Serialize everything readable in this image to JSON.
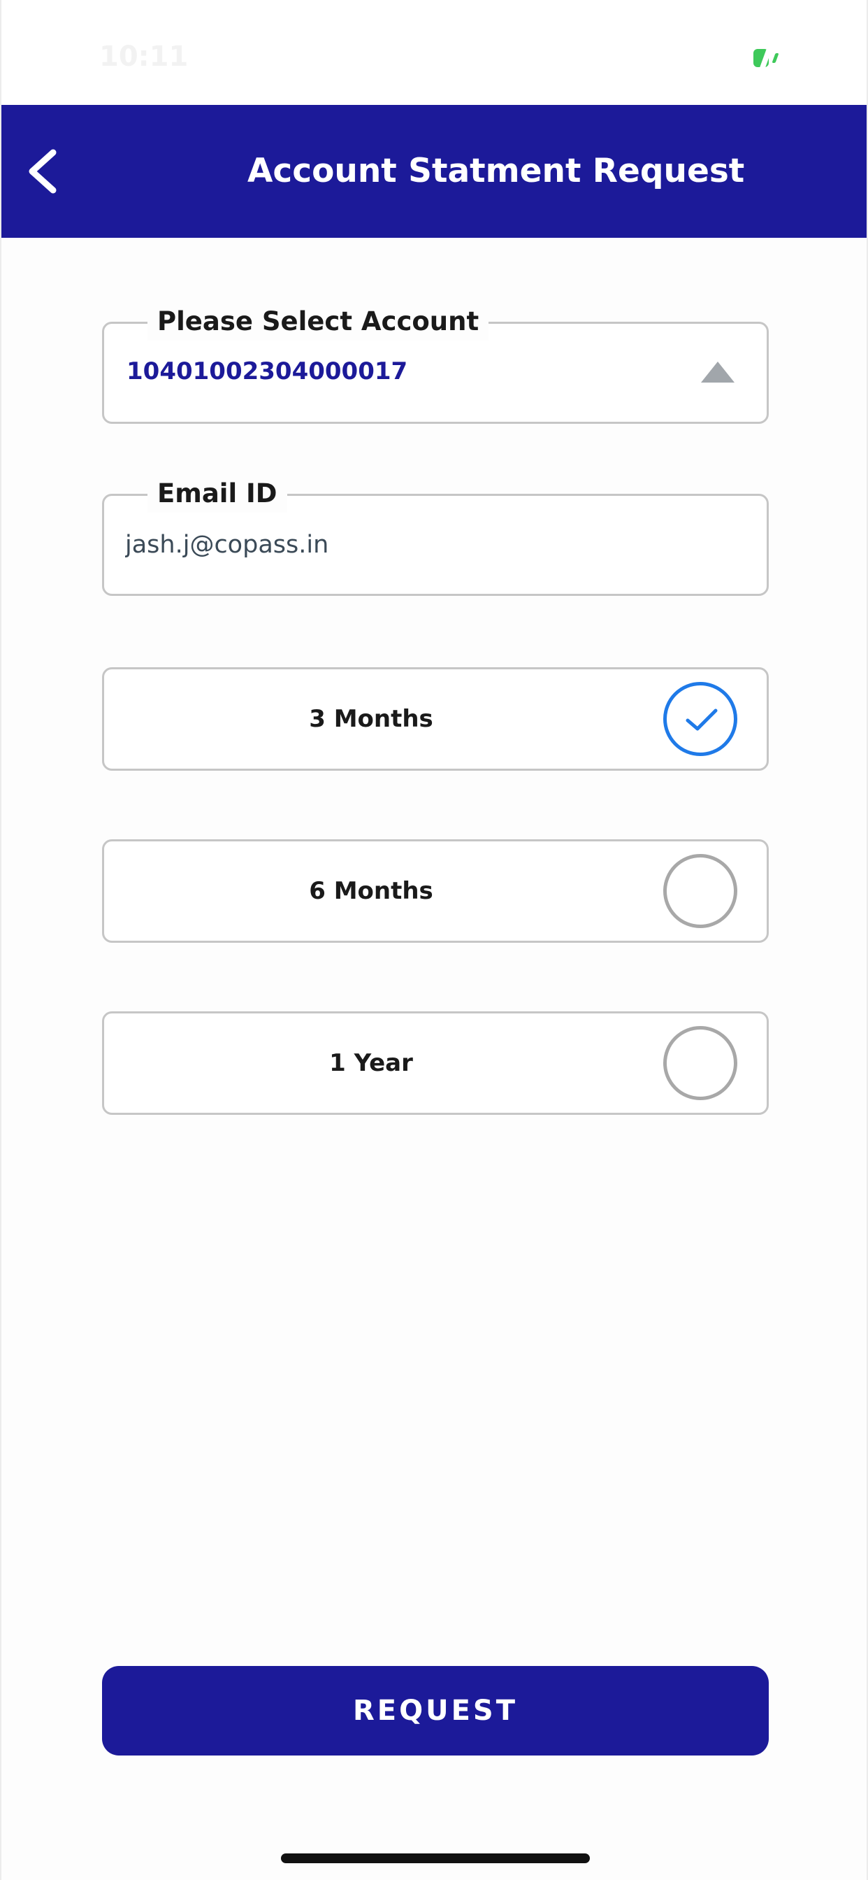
{
  "status_bar": {
    "time": "10:11",
    "battery_icon": "battery-charging-icon",
    "battery_color": "#3ec95a"
  },
  "header": {
    "title": "Account Statment Request",
    "back_icon": "chevron-left-icon",
    "background_color": "#1c1a99"
  },
  "account_field": {
    "label": "Please Select Account",
    "value": "10401002304000017",
    "dropdown_icon": "caret-up-icon"
  },
  "email_field": {
    "label": "Email ID",
    "value": "jash.j@copass.in"
  },
  "period_options": [
    {
      "label": "3 Months",
      "selected": true
    },
    {
      "label": "6 Months",
      "selected": false
    },
    {
      "label": "1 Year",
      "selected": false
    }
  ],
  "selection_color": "#1f7ae8",
  "request_button": {
    "label": "REQUEST"
  }
}
